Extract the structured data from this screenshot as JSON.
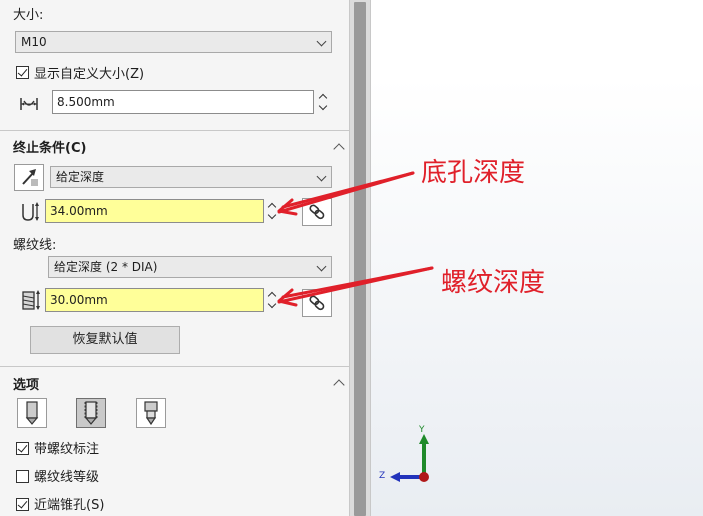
{
  "size": {
    "label": "大小:",
    "value": "M10"
  },
  "custom_size": {
    "label": "显示自定义大小(Z)",
    "checked": true,
    "diameter_value": "8.500mm",
    "icon": "diameter-icon"
  },
  "end_condition": {
    "header": "终止条件(C)",
    "type_value": "给定深度",
    "hole_depth_value": "34.00mm",
    "thread_label": "螺纹线:",
    "thread_type_value": "给定深度 (2 * DIA)",
    "thread_depth_value": "30.00mm",
    "restore_button": "恢复默认值",
    "field_color": "#ffff99"
  },
  "options": {
    "header": "选项",
    "checkboxes": [
      {
        "label": "带螺纹标注",
        "checked": true
      },
      {
        "label": "螺纹线等级",
        "checked": false
      },
      {
        "label": "近端锥孔(S)",
        "checked": true
      }
    ]
  },
  "annotations": {
    "hole_depth": "底孔深度",
    "thread_depth": "螺纹深度",
    "color": "#e0202a"
  },
  "triad": {
    "y": "Y",
    "z": "Z"
  }
}
